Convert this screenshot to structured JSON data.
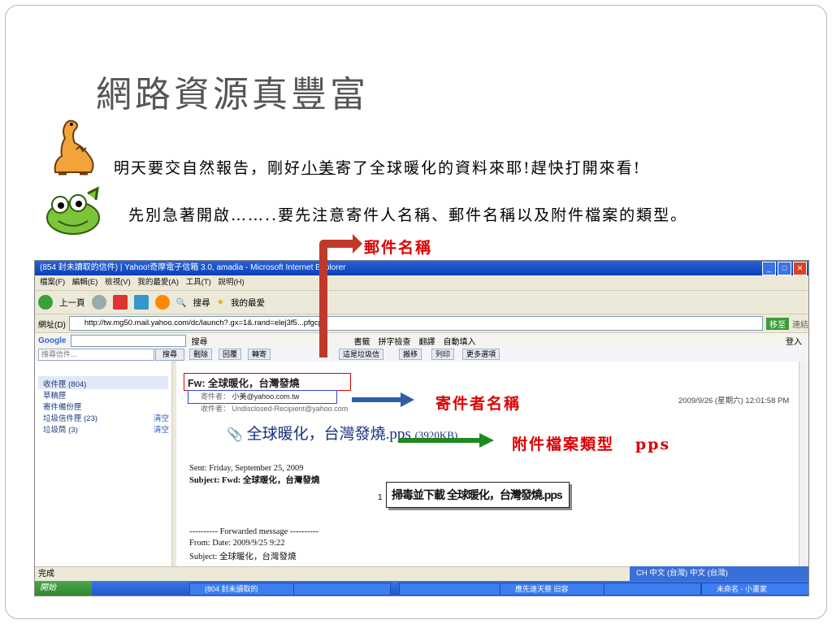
{
  "slide": {
    "title": "網路資源真豐富",
    "line1_a": "明天要交自然報告，剛好",
    "line1_name": "小美",
    "line1_b": "寄了全球暖化的資料來耶!趕快打開來看!",
    "line2": "先別急著開啟……..要先注意寄件人名稱、郵件名稱以及附件檔案的類型。",
    "annot_subject": "郵件名稱",
    "annot_sender": "寄件者名稱",
    "annot_attach": "附件檔案類型",
    "annot_attach_type": "pps"
  },
  "browser": {
    "window_title": "(854 封未讀取的信件) | Yahoo!奇摩電子信箱 3.0, amadia - Microsoft Internet Explorer",
    "menu": "檔案(F) 編輯(E) 檢視(V) 我的最愛(A) 工具(T) 說明(H)",
    "back_label": "上一頁",
    "search_label": "搜尋",
    "favorites_label": "我的最愛",
    "address_label": "網址(D)",
    "address_value": "http://tw.mg50.mail.yahoo.com/dc/launch?.gx=1&.rand=elej3f5...pfgcp",
    "go_label": "移至",
    "links_label": "連結",
    "google_label": "Google",
    "google_search": "搜尋",
    "google_bookmarks": "書籤",
    "google_spell": "拼字檢查",
    "google_translate": "翻譯",
    "google_autofill": "自動填入",
    "login_label": "登入"
  },
  "mail": {
    "search_placeholder": "搜尋信件...",
    "search_button": "搜尋",
    "toolbar": {
      "delete": "刪除",
      "reply": "回覆",
      "forward": "轉寄",
      "spam": "這是垃圾信",
      "move": "搬移",
      "print": "列印",
      "more": "更多選項"
    },
    "folders": [
      {
        "name": "收件匣 (804)",
        "clear": ""
      },
      {
        "name": "草稿匣",
        "clear": ""
      },
      {
        "name": "寄件備份匣",
        "clear": ""
      },
      {
        "name": "垃圾信件匣 (23)",
        "clear": "清空"
      },
      {
        "name": "垃圾筒 (3)",
        "clear": "清空"
      }
    ],
    "subject": "Fw: 全球暖化，台灣發燒",
    "sender_label": "寄件者：",
    "sender": "小美@yahoo.com.tw",
    "recipient_label": "收件者：",
    "recipient": "Undisclosed-Recipient@yahoo.com",
    "date": "2009/9/26 (星期六) 12:01:58 PM",
    "attachment_name": "全球暖化，台灣發燒.pps",
    "attachment_size": "(3920KB)",
    "body_sent": "Sent: Friday, September 25, 2009",
    "body_subject": "Subject: Fwd: 全球暖化，台灣發燒",
    "forwarded": "---------- Forwarded message ----------",
    "from_date": "From: Date: 2009/9/25 9:22",
    "subject2": "Subject: 全球暖化，台灣發燒",
    "popup_num": "1",
    "popup_text": "掃毒並下載 全球暖化，台灣發燒.pps",
    "status": "完成",
    "ime": "CH 中文 (台灣)    中文 (台灣)"
  },
  "taskbar": {
    "start": "開始",
    "tasks": [
      "(804 封未讀取的",
      "",
      "",
      "應先遠天祭 旧容",
      "",
      "未命名 - 小畫家"
    ]
  }
}
